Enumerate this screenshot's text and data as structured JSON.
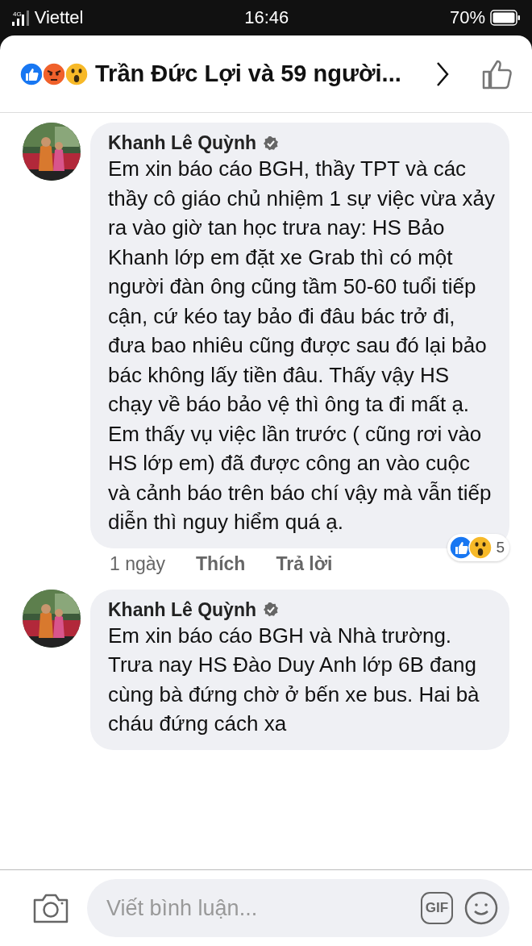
{
  "status_bar": {
    "carrier": "Viettel",
    "network": "4G",
    "time": "16:46",
    "battery": "70%"
  },
  "header": {
    "title": "Trần Đức Lợi và 59 người..."
  },
  "comments": [
    {
      "author": "Khanh Lê Quỳnh",
      "verified": true,
      "paragraphs": [
        "Em xin báo cáo BGH, thầy TPT và các thầy cô giáo chủ nhiệm 1 sự việc vừa xảy ra vào giờ tan học trưa nay: HS Bảo Khanh lớp em đặt xe Grab thì có một người đàn ông cũng tầm 50-60 tuổi tiếp cận, cứ kéo tay bảo đi đâu bác trở đi, đưa bao nhiêu cũng được sau đó lại bảo bác không lấy tiền đâu. Thấy vậy HS chạy về báo bảo vệ thì ông ta đi mất ạ.",
        "Em thấy vụ việc lần trước ( cũng rơi vào HS lớp em) đã được công an vào cuộc và cảnh báo trên báo chí vậy mà vẫn tiếp diễn thì nguy hiểm quá ạ."
      ],
      "actions": {
        "time": "1 ngày",
        "like": "Thích",
        "reply": "Trả lời"
      },
      "reaction_count": "5"
    },
    {
      "author": "Khanh Lê Quỳnh",
      "verified": true,
      "paragraphs": [
        "Em xin báo cáo BGH và Nhà trường.",
        "Trưa nay HS Đào Duy Anh lớp 6B đang cùng bà đứng chờ ở bến xe bus. Hai bà cháu đứng cách xa"
      ]
    }
  ],
  "composer": {
    "placeholder": "Viết bình luận...",
    "gif": "GIF"
  }
}
